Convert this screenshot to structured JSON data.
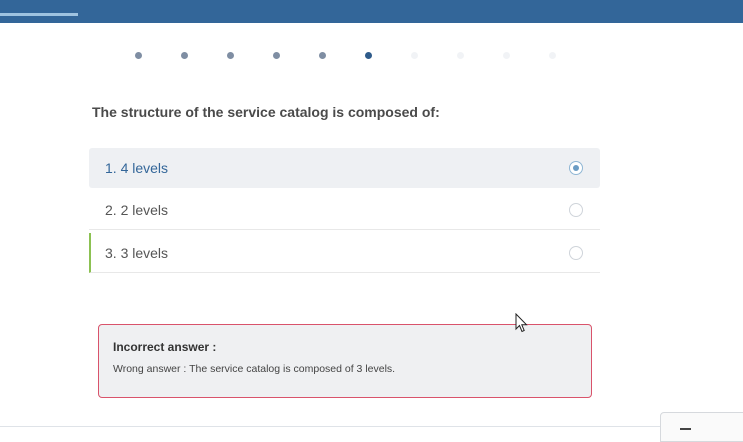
{
  "header": {
    "progress_fraction": 0.105
  },
  "steps": {
    "total": 10,
    "completed": 5,
    "current": 6
  },
  "question": {
    "text": "The structure of the service catalog is composed of:"
  },
  "options": [
    {
      "label": "1. 4 levels",
      "state": "selected"
    },
    {
      "label": "2. 2 levels",
      "state": "default"
    },
    {
      "label": "3. 3 levels",
      "state": "correct"
    }
  ],
  "feedback": {
    "title": "Incorrect answer :",
    "message": "Wrong answer : The service catalog is composed of 3 levels."
  },
  "colors": {
    "brand": "#336699",
    "correct": "#8cc152",
    "error_border": "#d9536b"
  },
  "icons": {
    "cursor": "mouse-pointer-icon",
    "corner": "minus-icon"
  }
}
